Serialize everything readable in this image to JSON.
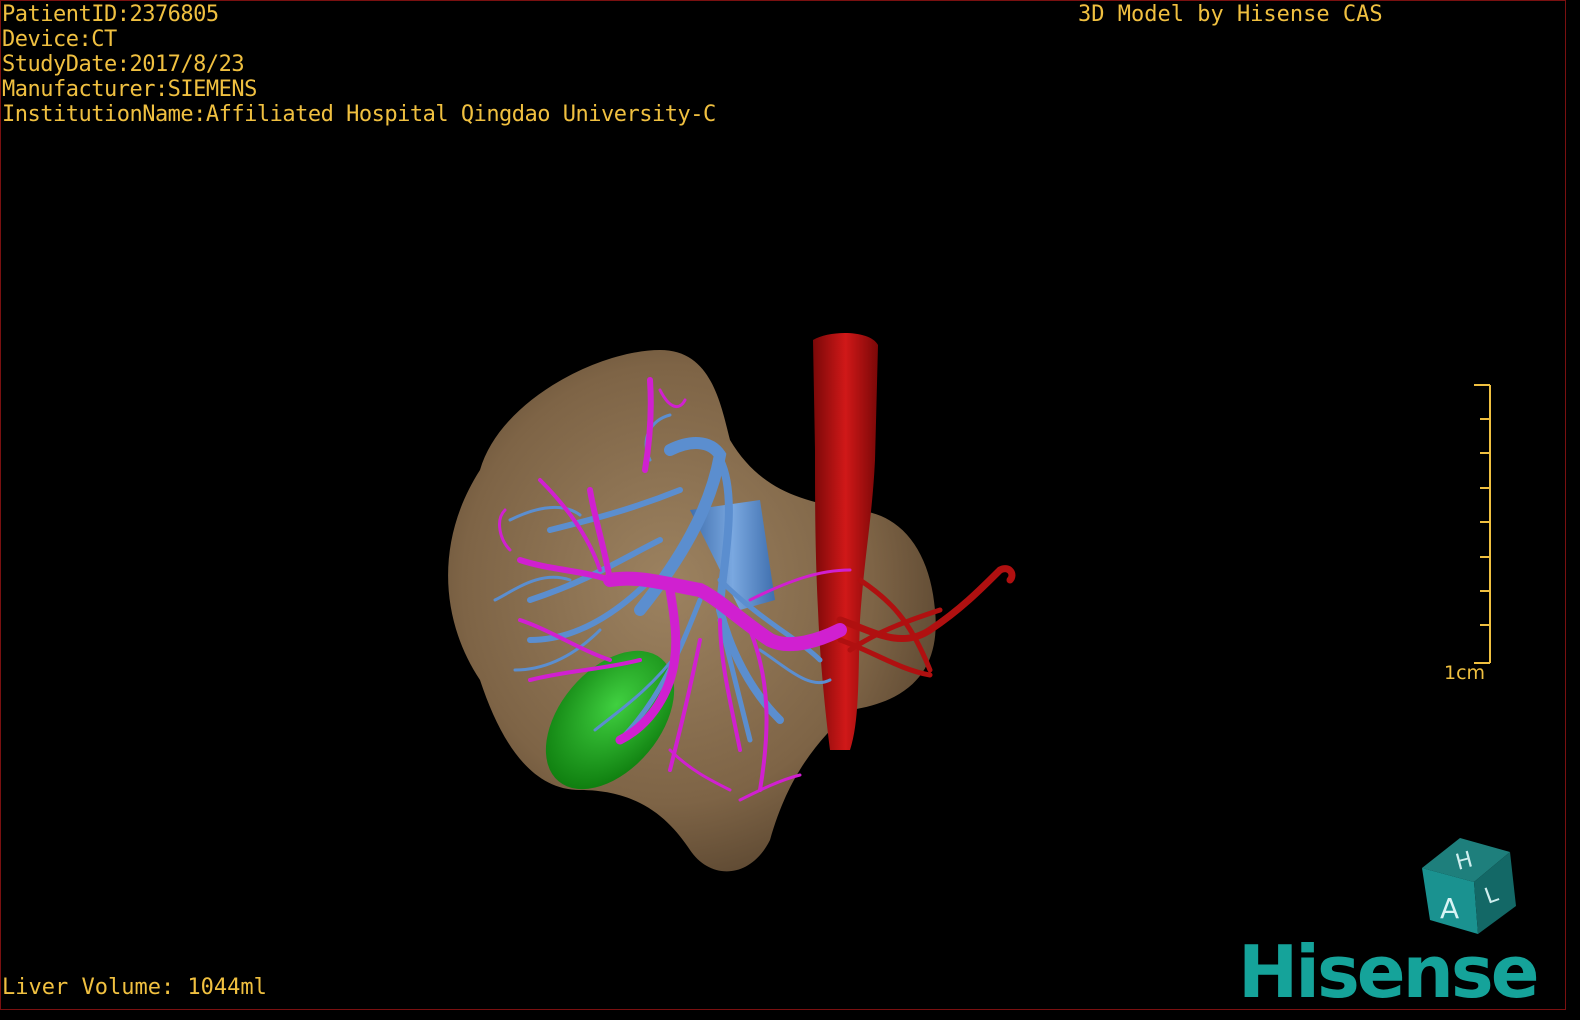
{
  "overlay": {
    "patient_id": "PatientID:2376805",
    "device": "Device:CT",
    "study_date": "StudyDate:2017/8/23",
    "manufacturer": "Manufacturer:SIEMENS",
    "institution": "InstitutionName:Affiliated Hospital Qingdao University-C",
    "credit": "3D Model by Hisense CAS",
    "liver_volume": "Liver Volume: 1044ml"
  },
  "scale_bar": {
    "label": "1cm"
  },
  "orientation_cube": {
    "face_top": "H",
    "face_front": "A",
    "face_side": "L"
  },
  "brand": {
    "logo": "Hisense"
  },
  "colors": {
    "text": "#f0c040",
    "background": "#000000",
    "liver": "#8a7050",
    "hepatic_vein": "#5b8ecf",
    "portal_vein": "#d020d0",
    "ivc_artery": "#b01010",
    "gallbladder": "#20a020",
    "brand": "#15a39a"
  },
  "icons": [
    "orientation-cube-icon",
    "scale-bar-icon"
  ]
}
